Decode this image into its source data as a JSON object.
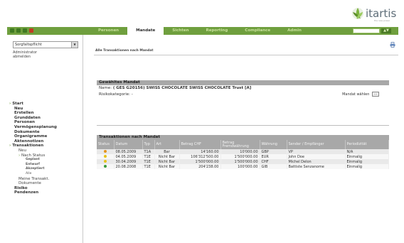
{
  "logo": {
    "text": "itartis",
    "tagline": "the new power"
  },
  "colors": {
    "nav_green": "#6f9f3e",
    "panel_grey": "#a8a8a8",
    "status_orange": "#e3941e",
    "status_yellow": "#e6c21a",
    "status_green": "#3a9a3a"
  },
  "nav": {
    "tabs": [
      "Personen",
      "Mandate",
      "Sichten",
      "Reporting",
      "Compliance",
      "Admin"
    ],
    "active_tab": "Mandate",
    "search_button": "▲▼"
  },
  "sidebar": {
    "select_value": "Sorgfaltspflicht",
    "user_line1": "Administrator",
    "user_line2": "abmelden",
    "menu": {
      "start": "Start",
      "neu": "Neu",
      "erstellen": "Erstellen",
      "grunddaten": "Grunddaten",
      "personen": "Personen",
      "vermoegensplanung": "Vermögensplanung",
      "dokumente": "Dokumente",
      "organigramme": "Organigramme",
      "aktennotizen": "Aktennotizen",
      "transaktionen": "Transaktionen",
      "t_neu": "Neu",
      "nach_status": "Nach Status",
      "geplant": "Geplant",
      "entwurf": "Entwurf",
      "akzeptiert": "Akzeptiert",
      "alle": "Alle",
      "meine": "Meine Transakt.",
      "t_dokumente": "Dokumente",
      "risiko": "Risiko",
      "pendenzen": "Pendenzen"
    }
  },
  "main": {
    "page_title": "Alle Transaktionen nach Mandat",
    "selected_mandate": {
      "header": "Gewähltes Mandat",
      "name_label": "Name:",
      "name_value": "( GES G20156) SWISS CHOCOLATE SWISS CHOCOLATE Trust [A]",
      "risk_label": "Risikokategorie:",
      "risk_value": "-",
      "choose_label": "Mandat wählen",
      "choose_button": "..."
    },
    "transactions": {
      "header": "Transaktionen nach Mandat",
      "columns": [
        "Status",
        "Datum",
        "Typ",
        "Art",
        "Betrag CHF",
        "Betrag Fremdwährung",
        "Währung",
        "Sender / Empfänger",
        "Periodizität"
      ],
      "rows": [
        {
          "status": "orange",
          "date": "08.05.2009",
          "type": "T1A",
          "art": "Bar",
          "chf": "14'160.00",
          "fx": "10'000.00",
          "cur": "GBP",
          "party": "VP",
          "period": "N/A"
        },
        {
          "status": "yellow",
          "date": "04.05.2009",
          "type": "T1E",
          "art": "Nicht Bar",
          "chf": "106'312'500.00",
          "fx": "1'500'000.00",
          "cur": "EUR",
          "party": "John Doe",
          "period": "Einmalig"
        },
        {
          "status": "yellow",
          "date": "30.04.2009",
          "type": "T1E",
          "art": "Nicht Bar",
          "chf": "1'500'000.00",
          "fx": "1'500'000.00",
          "cur": "CHF",
          "party": "Michel Delon",
          "period": "Einmalig"
        },
        {
          "status": "green",
          "date": "20.08.2008",
          "type": "T1E",
          "art": "Nicht Bar",
          "chf": "204'238.00",
          "fx": "100'000.00",
          "cur": "GIB",
          "party": "Battiste Senzanome",
          "period": "Einmalig"
        }
      ]
    }
  }
}
